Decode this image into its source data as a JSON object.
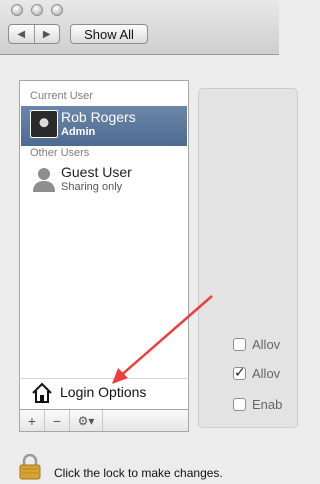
{
  "toolbar": {
    "nav_back": "◀",
    "nav_forward": "▶",
    "show_all_label": "Show All"
  },
  "userlist": {
    "current_user_header": "Current User",
    "current_user": {
      "name": "Rob Rogers",
      "role": "Admin",
      "avatar_icon": "user-photo"
    },
    "other_users_header": "Other Users",
    "other_users": [
      {
        "name": "Guest User",
        "role": "Sharing only",
        "avatar_icon": "guest-silhouette-icon"
      }
    ],
    "login_options_label": "Login Options",
    "login_options_icon": "house-icon",
    "add_label": "+",
    "remove_label": "−",
    "action_label": "⚙▾"
  },
  "right_panel": {
    "checkboxes": [
      {
        "label": "Allov",
        "checked": false
      },
      {
        "label": "Allov",
        "checked": true
      },
      {
        "label": "Enab",
        "checked": false
      }
    ]
  },
  "lock": {
    "message": "Click the lock to make changes.",
    "icon": "padlock-icon"
  },
  "colors": {
    "selection": "#5a769c",
    "annotation_arrow": "#e8403c"
  }
}
